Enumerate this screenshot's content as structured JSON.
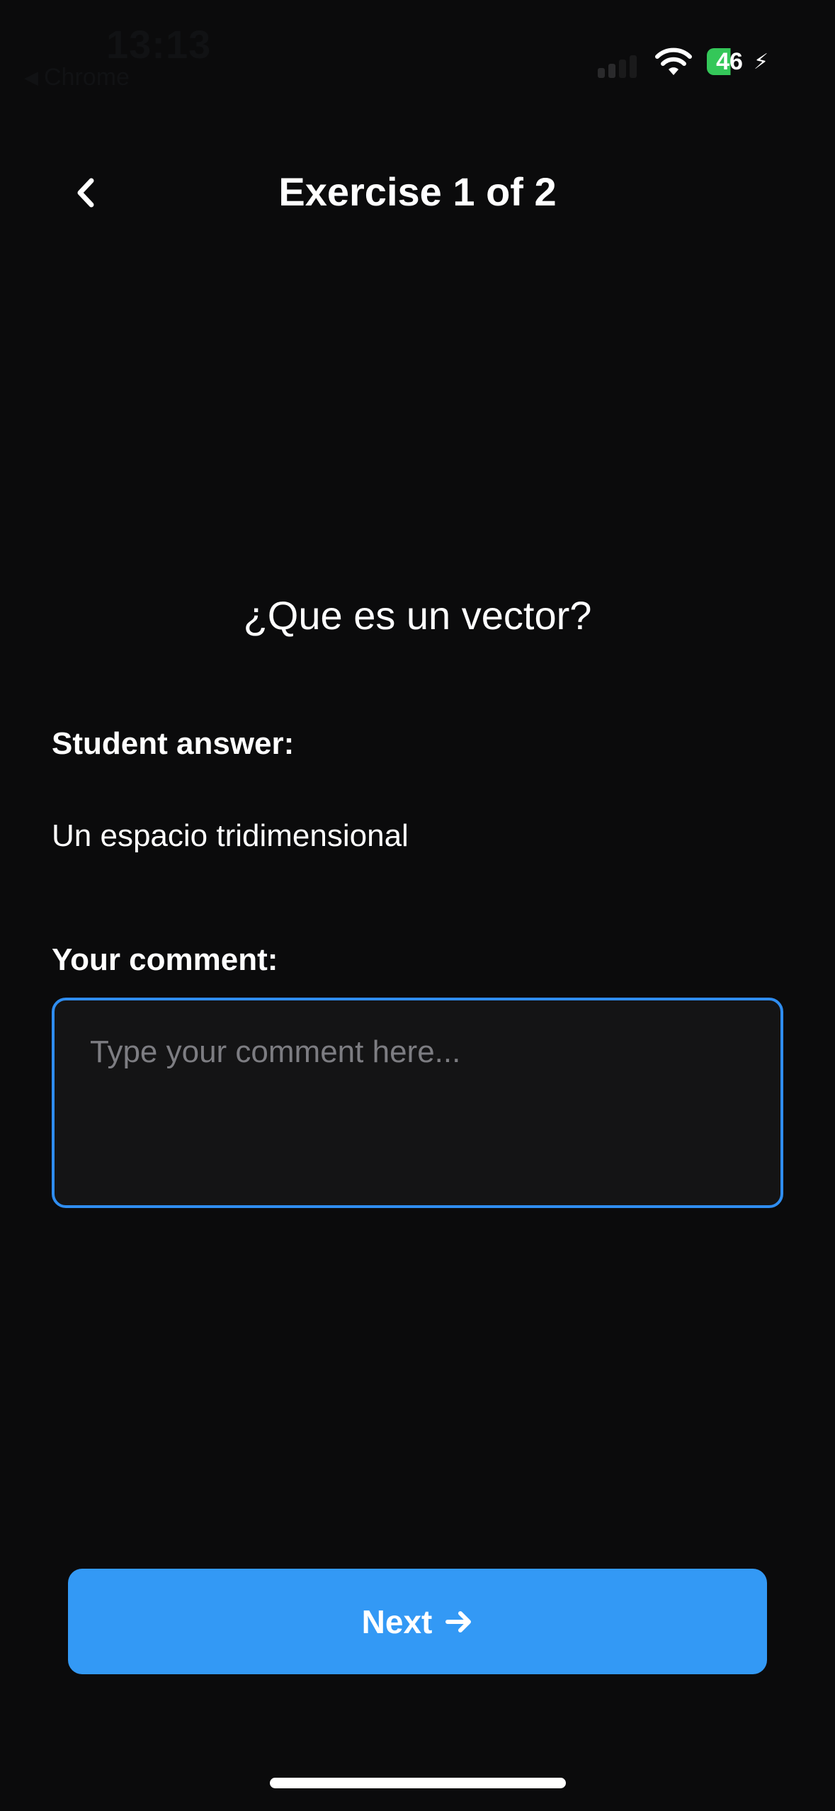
{
  "status_bar": {
    "time": "13:13",
    "back_app_label": "Chrome",
    "battery_level": "46",
    "signal_icon": "cellular-signal-icon",
    "wifi_icon": "wifi-icon",
    "battery_icon": "battery-charging-icon"
  },
  "header": {
    "title": "Exercise 1 of 2",
    "back_icon": "chevron-left-icon"
  },
  "exercise": {
    "question": "¿Que es un vector?",
    "student_answer_label": "Student answer:",
    "student_answer": "Un espacio tridimensional",
    "comment_label": "Your comment:",
    "comment_placeholder": "Type your comment here...",
    "comment_value": ""
  },
  "actions": {
    "next_label": "Next",
    "next_icon": "arrow-right-icon"
  },
  "colors": {
    "background": "#0b0b0c",
    "accent": "#3399f5",
    "input_border": "#2f8df0",
    "battery_green": "#34c759"
  }
}
